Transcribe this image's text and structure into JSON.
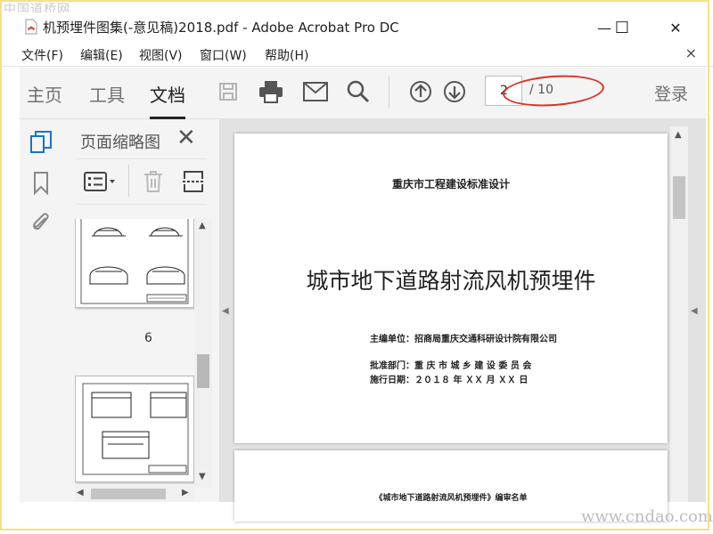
{
  "watermark_top": "中国道桥网",
  "watermark_bottom": "www.cndao.com",
  "window": {
    "title": "机预埋件图集(-意见稿)2018.pdf - Adobe Acrobat Pro DC",
    "minimize": "—",
    "maximize": "☐",
    "close": "✕"
  },
  "menu": {
    "items": [
      "文件(F)",
      "编辑(E)",
      "视图(V)",
      "窗口(W)",
      "帮助(H)"
    ],
    "close": "×"
  },
  "toolbar": {
    "tabs": [
      "主页",
      "工具",
      "文档"
    ],
    "active_tab": "文档",
    "icons": [
      "save-icon",
      "print-icon",
      "email-icon",
      "search-icon",
      "page-up-icon",
      "page-down-icon"
    ],
    "current_page": "2",
    "page_total": "/ 10",
    "login": "登录",
    "annotation_color": "#d9332a"
  },
  "leftrail": {
    "icons": [
      "page-thumbnails-icon",
      "bookmark-icon",
      "attachment-icon"
    ],
    "accent": "#1a73c8"
  },
  "thumbnails": {
    "title": "页面缩略图",
    "close": "✕",
    "page_label": "6"
  },
  "document": {
    "page1": {
      "header": "重庆市工程建设标准设计",
      "title": "城市地下道路射流风机预埋件",
      "editor": "主编单位：招商局重庆交通科研设计院有限公司",
      "approver": "批准部门：重 庆 市 城 乡 建 设 委 员 会",
      "date": "施行日期：２０１８ 年 ＸＸ 月 ＸＸ 日"
    },
    "page2": {
      "heading": "《城市地下道路射流风机预埋件》编审名单"
    }
  }
}
